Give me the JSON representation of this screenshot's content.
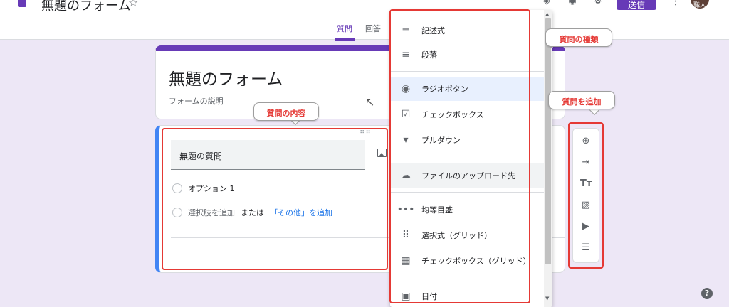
{
  "header": {
    "doc_title": "無題のフォーム",
    "send_label": "送信",
    "avatar_text": "職人",
    "tabs": [
      {
        "label": "質問",
        "active": true
      },
      {
        "label": "回答",
        "active": false
      }
    ]
  },
  "title_card": {
    "title": "無題のフォーム",
    "description": "フォームの説明"
  },
  "question": {
    "title": "無題の質問",
    "option1": "オプション 1",
    "add_option": "選択肢を追加",
    "or": "または",
    "add_other": "「その他」を追加"
  },
  "menu": {
    "items": [
      {
        "label": "記述式",
        "icon": "short-text-icon"
      },
      {
        "label": "段落",
        "icon": "paragraph-icon"
      },
      {
        "label": "ラジオボタン",
        "icon": "radio-icon"
      },
      {
        "label": "チェックボックス",
        "icon": "checkbox-icon"
      },
      {
        "label": "プルダウン",
        "icon": "dropdown-icon"
      },
      {
        "label": "ファイルのアップロード先",
        "icon": "cloud-upload-icon"
      },
      {
        "label": "均等目盛",
        "icon": "linear-scale-icon"
      },
      {
        "label": "選択式（グリッド）",
        "icon": "grid-icon"
      },
      {
        "label": "チェックボックス（グリッド）",
        "icon": "checkbox-grid-icon"
      },
      {
        "label": "日付",
        "icon": "calendar-icon"
      }
    ]
  },
  "toolbar": {
    "items": [
      "add-question-icon",
      "import-icon",
      "title-text-icon",
      "image-icon",
      "video-icon",
      "section-icon"
    ]
  },
  "annotations": {
    "question_types": "質問の種類",
    "add_question": "質問を追加",
    "question_content": "質問の内容"
  },
  "colors": {
    "accent": "#673ab7",
    "background": "#ede7f6",
    "annotation_red": "#e53935",
    "active_blue": "#4285f4"
  }
}
